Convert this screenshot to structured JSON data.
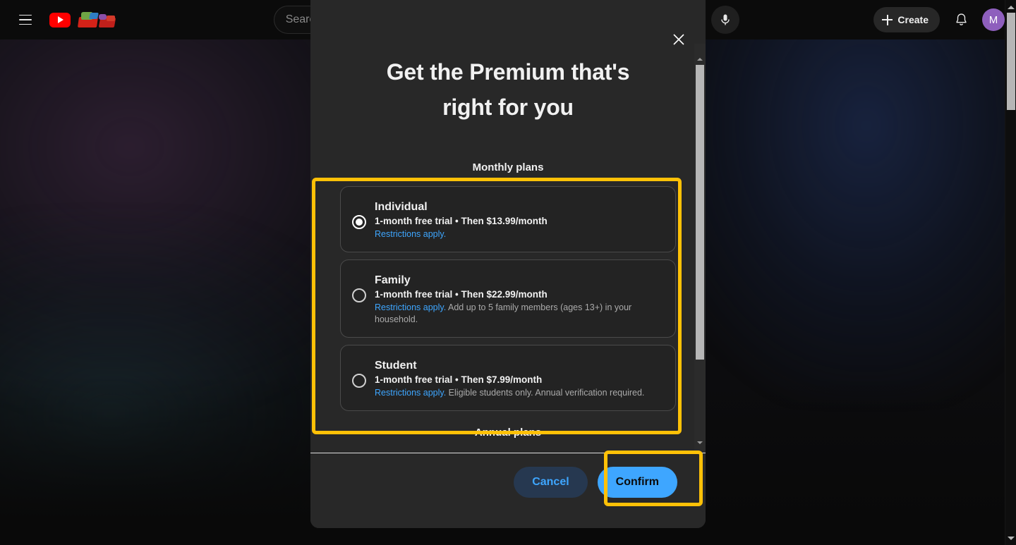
{
  "topbar": {
    "menu_icon": "hamburger-icon",
    "logo_icon": "youtube-logo-icon",
    "search": {
      "placeholder": "Search",
      "value": "",
      "icon": "search-icon"
    },
    "mic_icon": "microphone-icon",
    "create_label": "Create",
    "create_icon": "plus-icon",
    "notifications_icon": "bell-icon",
    "avatar_initial": "M"
  },
  "modal": {
    "close_icon": "close-icon",
    "title": "Get the Premium that's right for you",
    "section_label": "Monthly plans",
    "annual_label": "Annual plans",
    "plans": [
      {
        "name": "Individual",
        "price_line": "1-month free trial • Then $13.99/month",
        "restrictions_link": "Restrictions apply.",
        "note": "",
        "selected": true
      },
      {
        "name": "Family",
        "price_line": "1-month free trial • Then $22.99/month",
        "restrictions_link": "Restrictions apply.",
        "note": " Add up to 5 family members (ages 13+) in your household.",
        "selected": false
      },
      {
        "name": "Student",
        "price_line": "1-month free trial • Then $7.99/month",
        "restrictions_link": "Restrictions apply.",
        "note": " Eligible students only. Annual verification required.",
        "selected": false
      }
    ],
    "footer": {
      "cancel_label": "Cancel",
      "confirm_label": "Confirm"
    }
  },
  "colors": {
    "accent_blue": "#3ea6ff",
    "highlight_yellow": "#ffc107",
    "modal_bg": "#282828",
    "card_bg": "#232323",
    "avatar_purple": "#8e5fbd",
    "youtube_red": "#ff0000"
  }
}
